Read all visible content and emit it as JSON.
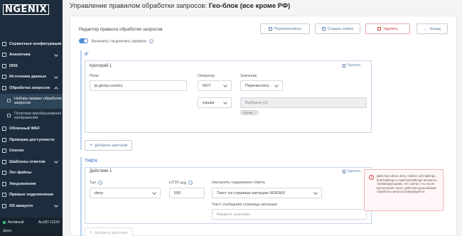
{
  "app": {
    "logo": "NGENIX"
  },
  "sidebar": {
    "items": [
      {
        "label": "Сервисные конфигурации",
        "chevron": false
      },
      {
        "label": "Аналитика",
        "chevron": true
      },
      {
        "label": "DNS",
        "chevron": false
      },
      {
        "label": "Источники данных",
        "chevron": true
      },
      {
        "label": "Обработка запросов",
        "chevron": true,
        "open": true
      }
    ],
    "sub_items": [
      {
        "label": "Наборы правил обработки запросов",
        "active": true
      },
      {
        "label": "Политики преобразования изображений",
        "active": false
      }
    ],
    "items_after": [
      {
        "label": "Облачный WAF",
        "chevron": false
      },
      {
        "label": "Проверка доступности",
        "chevron": false
      },
      {
        "label": "Списки",
        "chevron": false
      },
      {
        "label": "Шаблоны ответов",
        "chevron": true
      },
      {
        "label": "Лог-файлы",
        "chevron": false
      },
      {
        "label": "Уведомления",
        "chevron": false
      },
      {
        "label": "Прямые подключения",
        "chevron": false
      },
      {
        "label": "Об аккаунте",
        "chevron": true
      }
    ],
    "footer": {
      "status": "Активный",
      "account_id": "AcctID 13142",
      "plan": "Демо"
    }
  },
  "header": {
    "title_prefix": "Управление правилом обработки запросов:",
    "title_name": "Гео-блок (все кроме РФ)"
  },
  "editor": {
    "title": "Редактор правила обработки запросов",
    "buttons": {
      "rename": "Переименовать",
      "copy": "Создать копию",
      "delete": "Удалить",
      "back": "Назад"
    },
    "toggle_label": "Включить / выключить правило"
  },
  "if_section": {
    "keyword": "IF",
    "criteria_title": "Критерий 1",
    "delete_label": "Удалить",
    "field_label": "Поле",
    "field_value": "ip.geoip.country",
    "operator_label": "Оператор",
    "operator_value": "NOT",
    "operator2_value": "equals",
    "value_label": "Значение",
    "value_mode": "Перечислить",
    "selected_text": "Выбрано (1)",
    "tags": [
      "Россия"
    ],
    "add_label": "Добавить критерий"
  },
  "then_section": {
    "keyword": "THEN",
    "action_title": "Действие 1",
    "delete_label": "Удалить",
    "type_label": "Тип",
    "type_value": "deny",
    "http_label": "HTTP-код",
    "http_value": "500",
    "content_label": "Настроить содержание ответа",
    "content_value": "Текст на странице-заглушке NGENIX",
    "message_label": "Текст сообщения страницы-заглушки",
    "message_placeholder": "Введите значение",
    "add_label": "Добавить действие"
  },
  "alert": {
    "text": "Действия allow, deny, redirect, jsChallenge, botChallenge и captchaChallenge являются терминирующими. Это значит, что после выполнения такого действия дальнейшая обработка запроса прекращается."
  }
}
